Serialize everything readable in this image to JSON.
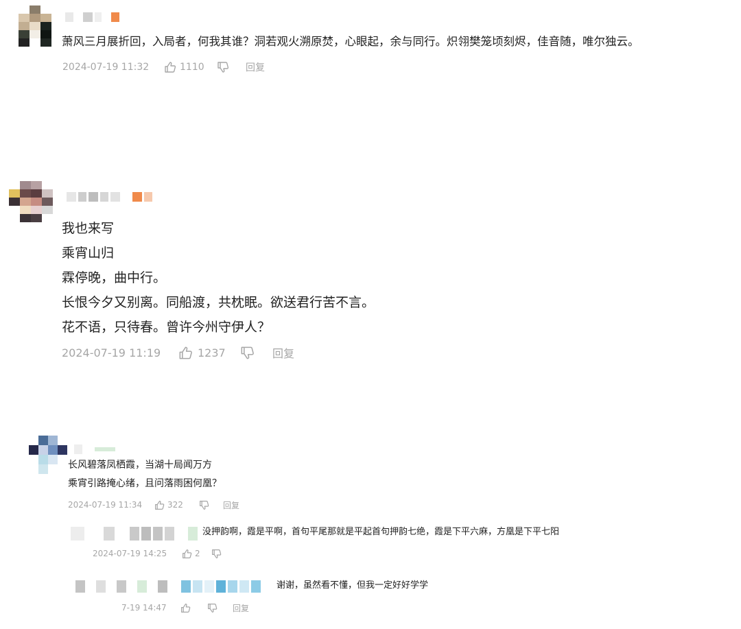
{
  "comments": [
    {
      "text": "萧风三月展折回，入局者，何我其谁？洞若观火溯原焚，心眼起，余与同行。炽翎樊笼顷刻烬，佳音随，唯尔独云。",
      "time": "2024-07-19 11:32",
      "likes": "1110",
      "reply_label": "回复"
    },
    {
      "lines": [
        "我也来写",
        "乘宵山归",
        "霖停晚，曲中行。",
        "长恨今夕又别离。同船渡，共枕眠。欲送君行苦不言。",
        "花不语，只待春。曾许今州守伊人？"
      ],
      "time": "2024-07-19 11:19",
      "likes": "1237",
      "reply_label": "回复"
    },
    {
      "lines": [
        "长风碧落凤栖霞，当湖十局闻万方",
        "乘宵引路掩心绪，且问落雨困何凰？"
      ],
      "time": "2024-07-19 11:34",
      "likes": "322",
      "reply_label": "回复"
    }
  ],
  "replies": [
    {
      "text": "没押韵啊，霞是平啊，首句平尾那就是平起首句押韵七绝，霞是下平六麻，方凰是下平七阳",
      "time": "2024-07-19 14:25",
      "likes": "2"
    },
    {
      "text": "谢谢，虽然看不懂，但我一定好好学学",
      "time": "7-19 14:47",
      "reply_label": "回复"
    }
  ],
  "colors": {
    "badge_orange": "#f08a4b",
    "meta_gray": "#a6a6a6",
    "text_dark": "#222222"
  },
  "icons": [
    "thumb-up-icon",
    "thumb-down-icon"
  ]
}
